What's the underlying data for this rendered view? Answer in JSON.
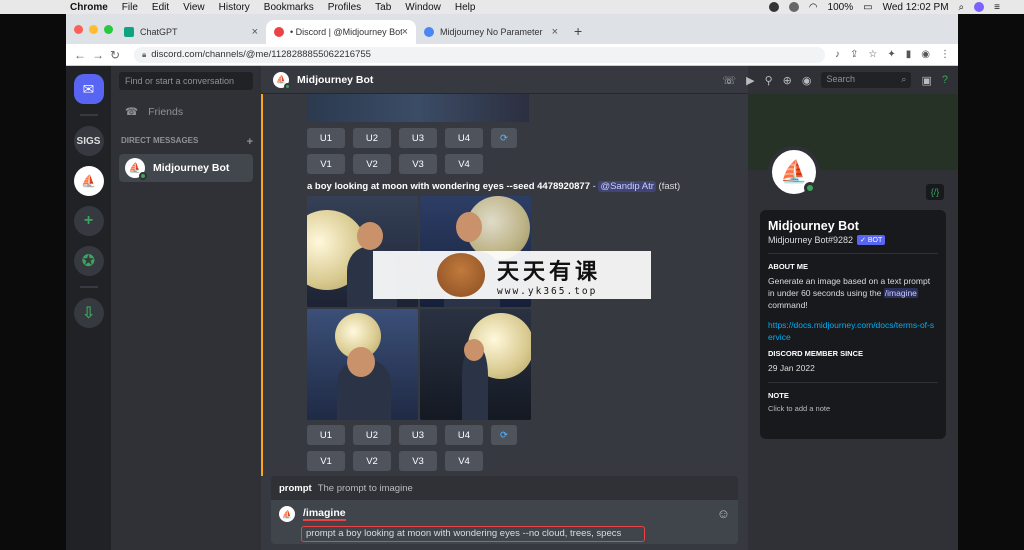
{
  "menubar": {
    "app": "Chrome",
    "items": [
      "File",
      "Edit",
      "View",
      "History",
      "Bookmarks",
      "Profiles",
      "Tab",
      "Window",
      "Help"
    ],
    "battery": "100%",
    "clock": "Wed 12:02 PM"
  },
  "browser": {
    "tabs": [
      {
        "label": "ChatGPT",
        "color": "#10a37f"
      },
      {
        "label": "• Discord | @Midjourney Bot",
        "color": "#ed4245"
      },
      {
        "label": "Midjourney No Parameter",
        "color": "#4b86f5"
      }
    ],
    "url": "discord.com/channels/@me/1128288855062216755"
  },
  "guilds": {
    "sigs": "SIGS"
  },
  "dmlist": {
    "search_placeholder": "Find or start a conversation",
    "friends": "Friends",
    "direct_messages": "DIRECT MESSAGES",
    "add": "+",
    "dm_item": "Midjourney Bot"
  },
  "channel": {
    "title": "Midjourney Bot",
    "search_placeholder": "Search"
  },
  "chat": {
    "upscale_buttons": [
      "U1",
      "U2",
      "U3",
      "U4"
    ],
    "variation_buttons": [
      "V1",
      "V2",
      "V3",
      "V4"
    ],
    "prompt_text": "a boy looking at moon with wondering eyes --seed 4478920877",
    "prompt_sep": " - ",
    "mention": "@Sandip Atr",
    "speed": " (fast)"
  },
  "input": {
    "hint_label": "prompt",
    "hint_desc": "The prompt to imagine",
    "command": "/imagine",
    "value": "prompt    a boy looking at moon with wondering eyes --no cloud, trees, specs"
  },
  "profile": {
    "name": "Midjourney Bot",
    "tag": "Midjourney Bot#9282",
    "badge": "✓ BOT",
    "about_title": "ABOUT ME",
    "about_text_1": "Generate an image based on a text prompt in under 60 seconds using the ",
    "about_cmd": "/imagine",
    "about_text_2": " command!",
    "link": "https://docs.midjourney.com/docs/terms-of-service",
    "member_since_title": "DISCORD MEMBER SINCE",
    "member_since": "29 Jan 2022",
    "note_title": "NOTE",
    "note_placeholder": "Click to add a note"
  },
  "watermark": {
    "cn": "天天有课",
    "url": "www.yk365.top"
  }
}
